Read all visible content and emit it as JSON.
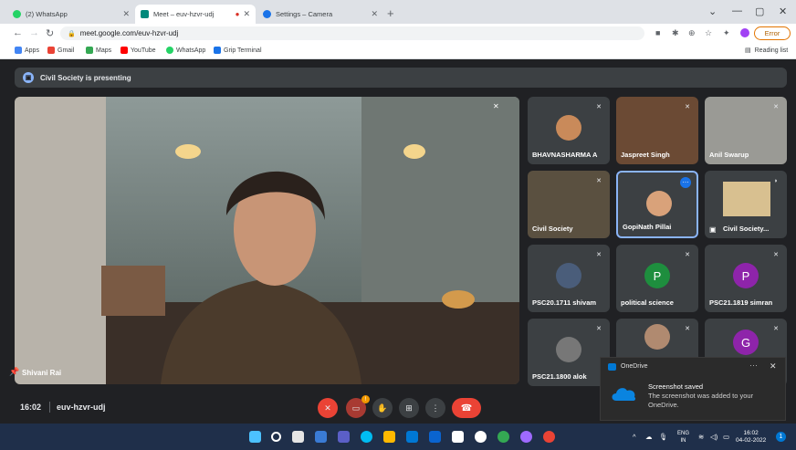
{
  "browser": {
    "tabs": [
      {
        "label": "(2) WhatsApp",
        "active": false,
        "favicon_color": "#25d366"
      },
      {
        "label": "Meet – euv-hzvr-udj",
        "active": true,
        "favicon_color": "#00897b"
      },
      {
        "label": "Settings – Camera",
        "active": false,
        "favicon_color": "#1a73e8"
      }
    ],
    "new_tab_icon": "+",
    "window_controls": {
      "collapse": "⌄",
      "minimize": "—",
      "maximize": "▢",
      "close": "✕"
    },
    "url": "meet.google.com/euv-hzvr-udj",
    "error_button": "Error",
    "bookmarks": [
      {
        "label": "Apps",
        "color": "#4285f4"
      },
      {
        "label": "Gmail",
        "color": "#ea4335"
      },
      {
        "label": "Maps",
        "color": "#34a853"
      },
      {
        "label": "YouTube",
        "color": "#ff0000"
      },
      {
        "label": "WhatsApp",
        "color": "#25d366"
      },
      {
        "label": "Grip Terminal",
        "color": "#1a73e8"
      }
    ],
    "reading_list": "Reading list"
  },
  "meet": {
    "presenting_banner": "Civil Society is presenting",
    "main_speaker": "Shivani Rai",
    "participants": [
      {
        "name": "BHAVNASHARMA A",
        "kind": "photo",
        "color": "#c98a5a"
      },
      {
        "name": "Jaspreet Singh",
        "kind": "video",
        "color": "#6b4a34"
      },
      {
        "name": "Anil Swarup",
        "kind": "video",
        "color": "#9a9a95"
      },
      {
        "name": "Civil Society",
        "kind": "video",
        "color": "#5a5040"
      },
      {
        "name": "GopiNath Pillai",
        "kind": "photo",
        "color": "#d9a27a"
      },
      {
        "name": "Civil Society...",
        "kind": "screen",
        "color": "#d8c090"
      },
      {
        "name": "PSC20.1711 shivam",
        "kind": "photo",
        "color": "#4a5d7a"
      },
      {
        "name": "political science",
        "kind": "letter",
        "letter": "P",
        "color": "#1e8e3e"
      },
      {
        "name": "PSC21.1819 simran",
        "kind": "letter",
        "letter": "P",
        "color": "#8e24aa"
      },
      {
        "name": "PSC21.1800 alok",
        "kind": "photo",
        "color": "#777777"
      },
      {
        "name": "",
        "kind": "photo",
        "color": "#b08a70"
      },
      {
        "name": "",
        "kind": "letter",
        "letter": "G",
        "color": "#8e24aa"
      }
    ],
    "time": "16:02",
    "meeting_code": "euv-hzvr-udj",
    "camera_badge": "!",
    "controls": {
      "mic": "mic-off",
      "camera": "camera-off",
      "raise_hand": "raise-hand",
      "present": "present",
      "more": "more",
      "leave": "leave-call"
    }
  },
  "toast": {
    "app": "OneDrive",
    "title": "Screenshot saved",
    "body": "The screenshot was added to your OneDrive."
  },
  "taskbar": {
    "icons_colors": [
      "#4cc2ff",
      "#ffffff",
      "#ffffff",
      "#ffb900",
      "#e81123",
      "#0078d4",
      "#ffb900",
      "#0078d4",
      "#ffffff",
      "#00bcf2",
      "#ffffff",
      "#ffc83d",
      "#9e6aff",
      "#ff6a00"
    ],
    "language": "ENG",
    "region": "IN",
    "time": "16:02",
    "date": "04-02-2022",
    "notifications": "1"
  }
}
